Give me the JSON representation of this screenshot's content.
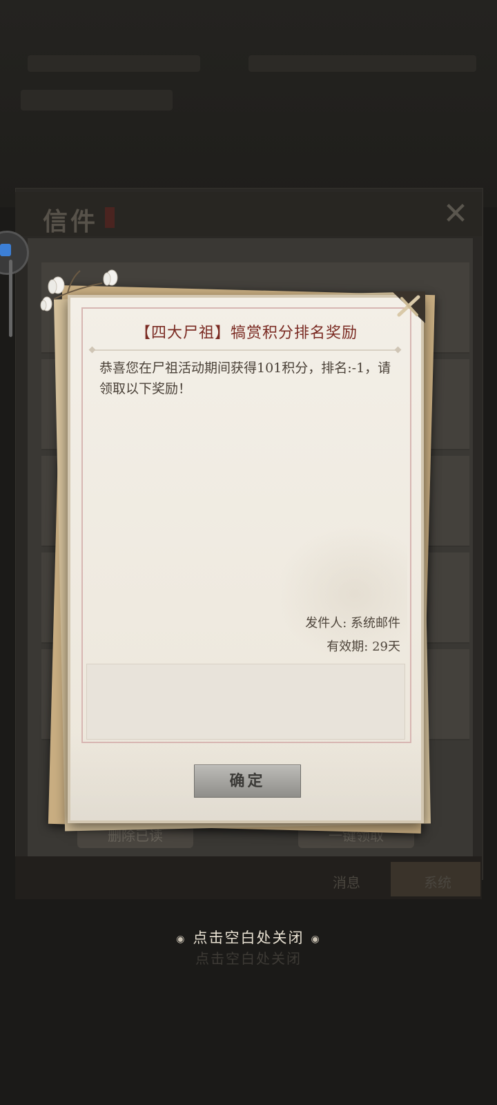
{
  "background_window": {
    "title": "信件",
    "tabs": [
      "消息",
      "系统"
    ],
    "buttons": [
      "删除已读",
      "一键领取"
    ],
    "close_hint_duplicate": "点击空白处关闭"
  },
  "mail": {
    "title": "【四大尸祖】犒赏积分排名奖励",
    "body": "恭喜您在尸祖活动期间获得101积分，排名:-1，请领取以下奖励！",
    "sender_label": "发件人: 系统邮件",
    "validity_label": "有效期: 29天",
    "confirm_label": "确定"
  },
  "close_hint": "点击空白处关闭",
  "colors": {
    "title": "#7a2a22",
    "body_text": "#4a4138",
    "paper": "#f1ede4",
    "frame": "#d7b6b2",
    "button": "#a6a5a1",
    "overlay": "#1b1a18"
  },
  "icons": {
    "close_bg": "close-icon",
    "corner": "ribbon-corner-icon",
    "flowers": "magnolia-flower-icon"
  }
}
